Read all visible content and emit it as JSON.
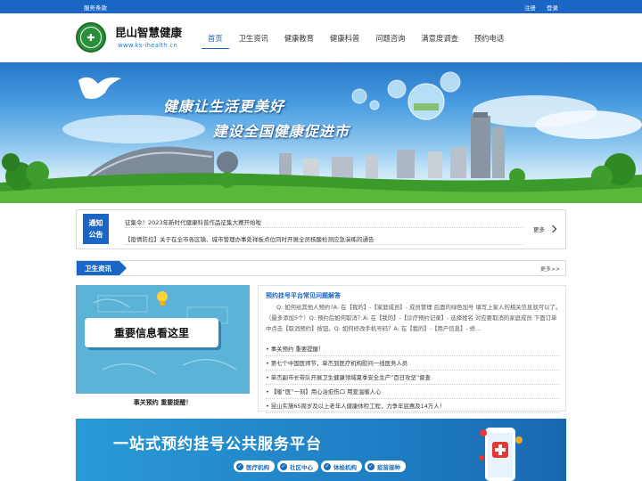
{
  "topbar": {
    "service_terms": "服务条款",
    "register": "注册",
    "login": "登录"
  },
  "header": {
    "site_title": "昆山智慧健康",
    "site_url": "www.ks-ihealth.cn",
    "nav": [
      "首页",
      "卫生资讯",
      "健康教育",
      "健康科普",
      "问题咨询",
      "满意度调查",
      "预约电话"
    ],
    "active_nav": "首页"
  },
  "banner": {
    "line1": "健康让生活更美好",
    "line2": "建设全国健康促进市"
  },
  "notice": {
    "tag_line1": "通知",
    "tag_line2": "公告",
    "items": [
      "征集令！2023年新时代健康科普作品征集大赛开始啦",
      "【疫情防控】关于在全市各区镇、城市管理办事处祥板点位同时开展全员核酸检测应急演练的通告"
    ],
    "more": "更多"
  },
  "section": {
    "title": "卫生资讯",
    "more": "更多>>"
  },
  "image_card": {
    "board_text": "重要信息看这里",
    "caption": "事关预约 重要提醒！"
  },
  "news": {
    "headline": "预约挂号平台常见问题解答",
    "summary": "Q: 如何给其他人预约?A: 在【我的】-【家庭成员】- 成员管理 后面的绿色加号 填写上家人的相关信息就可以了。（最多添加5个）Q: 预约后如何取消？A: 在【我的】-【诊疗预约记录】- 选择姓名 对应要取消的家庭成员 下面订单中点击【取消预约】按钮。Q: 如何修改手机号码？A: 在【我的】-【用户信息】- 修...",
    "items": [
      "事关预约 重要提醒！",
      "第七个中国医师节，单杰到医疗机构慰问一线医务人员",
      "单杰副市长带队开展卫生健康领域夏季安全生产“百日攻坚”督查",
      "【暖“医”一刻】用心治愈伤口 用爱温暖人心",
      "昆山实施65周岁及以上老年人健康体检工程，力争年底惠及14万人！"
    ]
  },
  "bottom_banner": {
    "title": "一站式预约挂号公共服务平台",
    "tags": [
      "医疗机构",
      "社区中心",
      "体检机构",
      "疫苗接种"
    ]
  },
  "colors": {
    "primary": "#1a66c4",
    "logo_green": "#2a8f3a",
    "banner_sky": "#4a9de0",
    "grass": "#3a9a2a"
  }
}
